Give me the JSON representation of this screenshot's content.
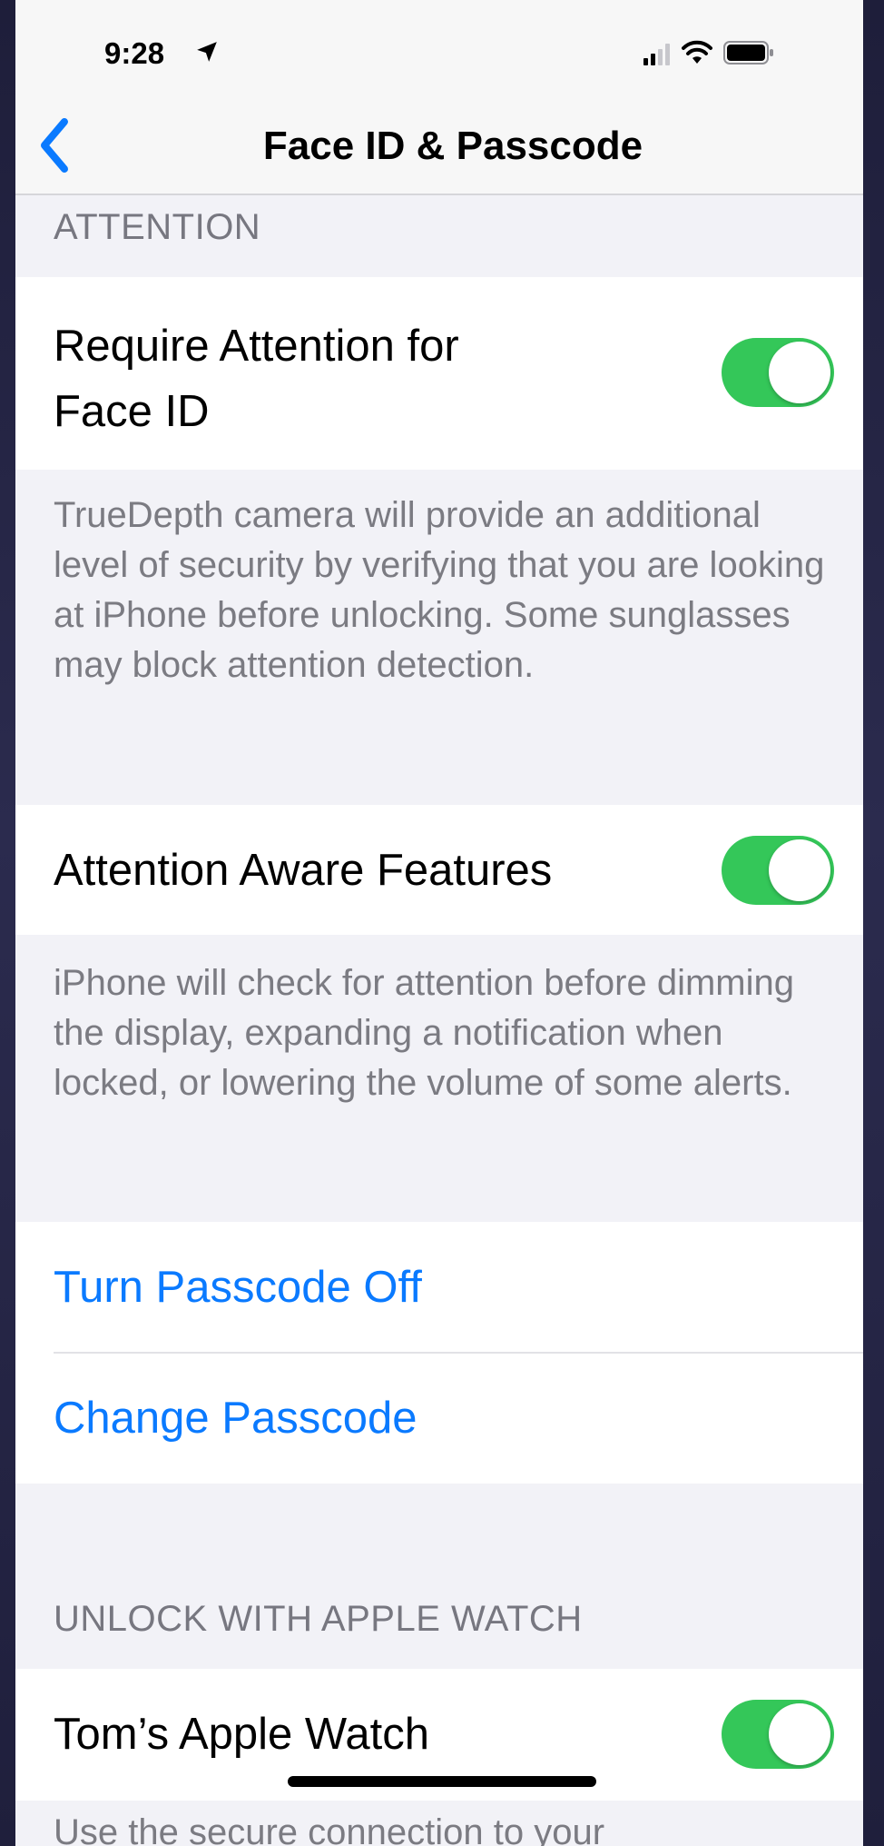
{
  "status_bar": {
    "time": "9:28",
    "icons": [
      "location-arrow-icon",
      "signal-icon",
      "wifi-icon",
      "battery-icon"
    ]
  },
  "nav": {
    "back_icon": "chevron-left-icon",
    "title": "Face ID & Passcode"
  },
  "attention": {
    "header": "ATTENTION",
    "require_attention": {
      "label_line1": "Require Attention for",
      "label_line2": "Face ID",
      "enabled": true
    },
    "require_attention_footer": "TrueDepth camera will provide an additional level of security by verifying that you are looking at iPhone before unlocking. Some sunglasses may block attention detection.",
    "attention_aware": {
      "label": "Attention Aware Features",
      "enabled": true
    },
    "attention_aware_footer": "iPhone will check for attention before dimming the display, expanding a notification when locked, or lowering the volume of some alerts."
  },
  "passcode": {
    "turn_off_label": "Turn Passcode Off",
    "change_label": "Change Passcode"
  },
  "apple_watch": {
    "header": "UNLOCK WITH APPLE WATCH",
    "watch": {
      "label": "Tom’s Apple Watch",
      "enabled": true
    },
    "footer_partial": "Use the secure connection to your"
  },
  "colors": {
    "toggle_on": "#34c759",
    "link": "#0a7aff",
    "background": "#f2f2f7"
  }
}
